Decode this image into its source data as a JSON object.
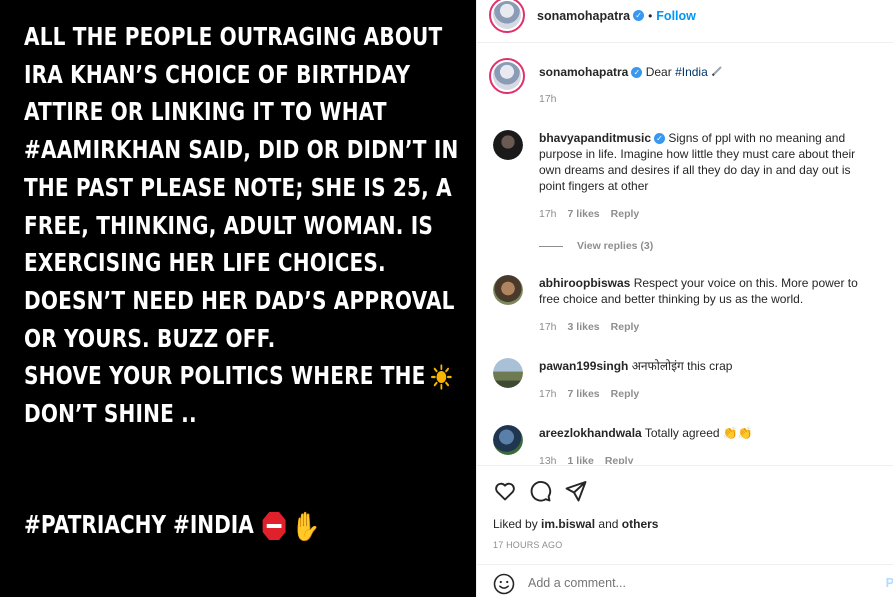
{
  "post_image": {
    "lines": [
      "ALL THE PEOPLE OUTRAGING ABOUT",
      "IRA KHAN’S CHOICE OF BIRTHDAY",
      "ATTIRE  OR LINKING IT TO WHAT",
      "#AAMIRKHAN SAID, DID OR DIDN’T IN",
      "THE PAST PLEASE NOTE; SHE IS 25, A",
      "FREE, THINKING, ADULT WOMAN. IS",
      "EXERCISING HER LIFE CHOICES.",
      "DOESN’T NEED HER DAD’S APPROVAL",
      "OR YOURS. BUZZ OFF.",
      "SHOVE YOUR POLITICS WHERE THE",
      "DON’T SHINE .."
    ],
    "hashtags": "#PATRIACHY #INDIA",
    "hand_emoji": "✋"
  },
  "header": {
    "username": "sonamohapatra",
    "dot": "•",
    "follow": "Follow"
  },
  "caption": {
    "username": "sonamohapatra",
    "text": "Dear",
    "hashtag": "#India",
    "time": "17h"
  },
  "comments": [
    {
      "username": "bhavyapanditmusic",
      "verified": true,
      "text": "Signs of ppl with no meaning and purpose in life. Imagine how little they must care about their own dreams and desires if all they do day in and day out is point fingers at other",
      "time": "17h",
      "likes": "7 likes",
      "reply": "Reply",
      "view_replies": "View replies (3)"
    },
    {
      "username": "abhiroopbiswas",
      "text": "Respect your voice on this. More power to free choice and better thinking by us as the world.",
      "time": "17h",
      "likes": "3 likes",
      "reply": "Reply"
    },
    {
      "username": "pawan199singh",
      "text": "अनफोलोइंग this crap",
      "time": "17h",
      "likes": "7 likes",
      "reply": "Reply"
    },
    {
      "username": "areezlokhandwala",
      "text": "Totally agreed 👏👏",
      "time": "13h",
      "likes": "1 like",
      "reply": "Reply"
    }
  ],
  "actions": {
    "liked_by_prefix": "Liked by",
    "liked_by_user": "im.biswal",
    "liked_by_and": "and",
    "liked_by_others": "others",
    "timestamp": "17 HOURS AGO",
    "comment_placeholder": "Add a comment...",
    "post_label": "P"
  },
  "colors": {
    "accent": "#0095f6",
    "hashtag": "#00376b",
    "muted": "#8e8e8e",
    "image_bg": "#000000"
  }
}
